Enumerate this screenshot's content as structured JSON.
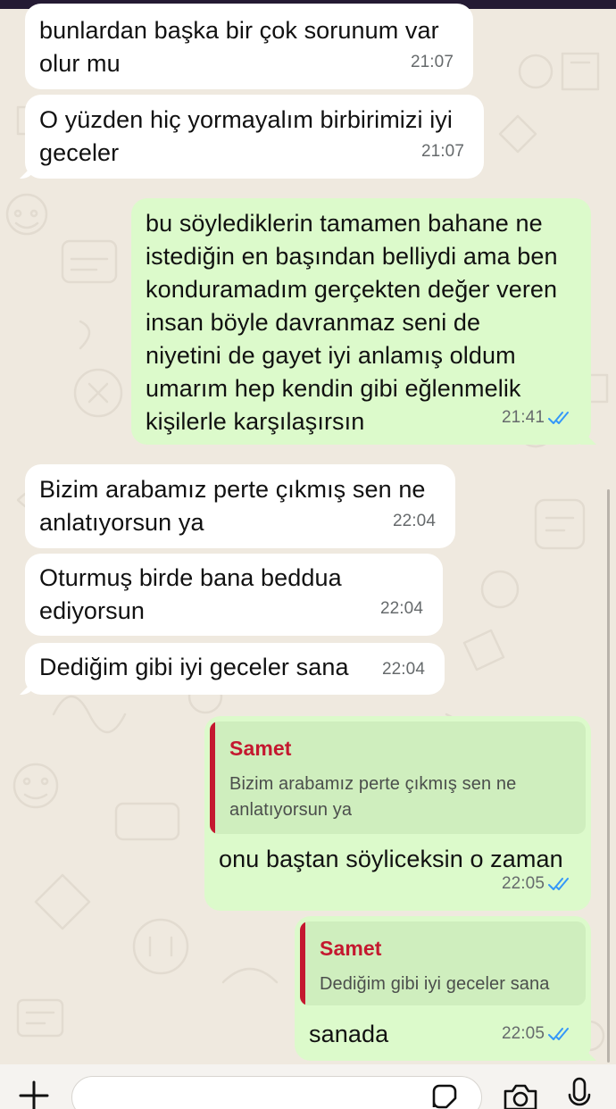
{
  "messages": [
    {
      "dir": "in",
      "text": "bunlardan başka bir çok sorunum var\nolur mu",
      "time": "21:07"
    },
    {
      "dir": "in",
      "text": "O yüzden hiç yormayalım birbirimizi iyi\ngeceler",
      "time": "21:07"
    },
    {
      "dir": "out",
      "text": "bu söylediklerin tamamen bahane ne\nistediğin en başından belliydi ama ben\nkonduramadım gerçekten değer veren\ninsan böyle davranmaz seni de\nniyetini de gayet iyi anlamış oldum\numarım hep kendin gibi eğlenmelik\nkişilerle karşılaşırsın",
      "time": "21:41",
      "read": true
    },
    {
      "dir": "in",
      "text": "Bizim arabamız perte çıkmış sen ne\nanlatıyorsun ya",
      "time": "22:04"
    },
    {
      "dir": "in",
      "text": "Oturmuş birde bana beddua\nediyorsun",
      "time": "22:04"
    },
    {
      "dir": "in",
      "text": "Dediğim gibi iyi geceler sana",
      "time": "22:04"
    },
    {
      "dir": "out",
      "reply_to": {
        "name": "Samet",
        "text": "Bizim arabamız perte çıkmış sen ne\nanlatıyorsun ya"
      },
      "text": "onu baştan söyliceksin o zaman",
      "time": "22:05",
      "read": true
    },
    {
      "dir": "out",
      "reply_to": {
        "name": "Samet",
        "text": "Dediğim gibi iyi geceler sana"
      },
      "text": "sanada",
      "time": "22:05",
      "read": true
    }
  ],
  "colors": {
    "background": "#efe9df",
    "incoming_bubble": "#ffffff",
    "outgoing_bubble": "#dcfacb",
    "read_ticks": "#3497f9",
    "reply_accent": "#c4182f"
  },
  "composer": {
    "icons": [
      "plus-icon",
      "sticker-icon",
      "camera-icon",
      "microphone-icon"
    ]
  }
}
